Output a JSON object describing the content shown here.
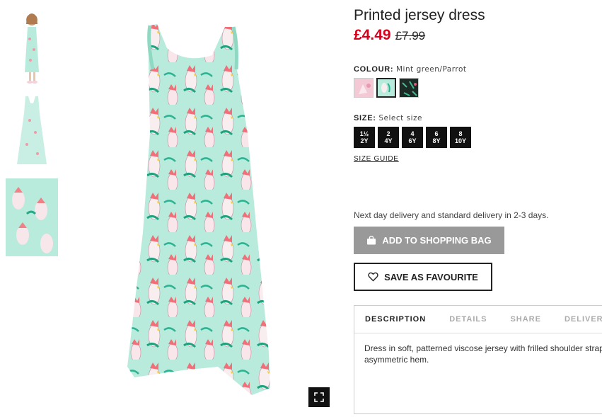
{
  "product": {
    "title": "Printed jersey dress",
    "price_now": "£4.49",
    "price_old": "£7.99"
  },
  "colour": {
    "label": "COLOUR:",
    "value": "Mint green/Parrot",
    "swatches": [
      {
        "name": "Light pink/Unicorn",
        "color": "#f4c9d6"
      },
      {
        "name": "Mint green/Parrot",
        "color": "#b9ebdd"
      },
      {
        "name": "Dark green/Patterned",
        "color": "#1c2b26"
      }
    ]
  },
  "size": {
    "label": "SIZE:",
    "value": "Select size",
    "options": [
      {
        "top": "1½",
        "bottom": "2Y"
      },
      {
        "top": "2",
        "bottom": "4Y"
      },
      {
        "top": "4",
        "bottom": "6Y"
      },
      {
        "top": "6",
        "bottom": "8Y"
      },
      {
        "top": "8",
        "bottom": "10Y"
      }
    ],
    "guide": "SIZE GUIDE"
  },
  "delivery_text": "Next day delivery and standard delivery in 2-3 days.",
  "buttons": {
    "add_to_bag": "ADD TO SHOPPING BAG",
    "save_favourite": "SAVE AS FAVOURITE"
  },
  "tabs": {
    "items": [
      "DESCRIPTION",
      "DETAILS",
      "SHARE",
      "DELIVERY"
    ],
    "active": "DESCRIPTION",
    "description_line1": "Dress in soft, patterned viscose jersey with frilled shoulder straps",
    "description_line2": "asymmetric hem."
  },
  "icons": {
    "zoom": "fullscreen-icon",
    "bag": "shopping-bag-icon",
    "heart": "heart-icon"
  },
  "colors": {
    "price_red": "#d6001c",
    "dress_mint": "#b9ebdd",
    "button_grey": "#999999"
  }
}
